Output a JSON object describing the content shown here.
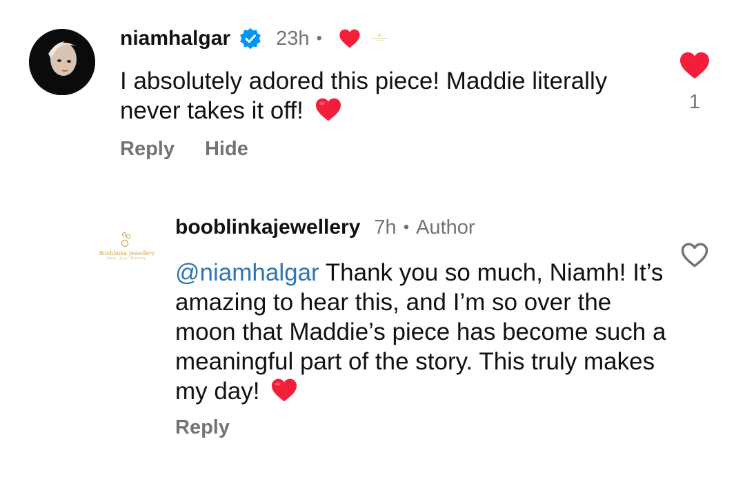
{
  "comments": [
    {
      "username": "niamhalgar",
      "verified": true,
      "time": "23h",
      "separator": "•",
      "creator_liked": true,
      "creator_brand_mark": "Booblinka Jewellery",
      "text": "I absolutely adored this piece! Maddie literally never takes it off!",
      "emoji": "red-heart",
      "actions": [
        "Reply",
        "Hide"
      ],
      "liked": true,
      "like_count": "1"
    },
    {
      "username": "booblinkajewellery",
      "time": "7h",
      "separator": "•",
      "badge": "Author",
      "avatar_brand": "Booblinka Jewellery",
      "avatar_tagline": "Han. Joy. Beauty",
      "mention": "@niamhalgar",
      "text": "Thank you so much, Niamh! It’s amazing to hear this, and I’m so over the moon that Maddie’s piece has become such a meaningful part of the story. This truly makes my day!",
      "emoji": "red-heart",
      "actions": [
        "Reply"
      ],
      "liked": false
    }
  ],
  "colors": {
    "heart_red": "#f41e3b",
    "muted_gray": "#737373",
    "verified_blue": "#0095f6",
    "mention_blue": "#2e74b5",
    "brand_gold": "#c9a74a"
  }
}
